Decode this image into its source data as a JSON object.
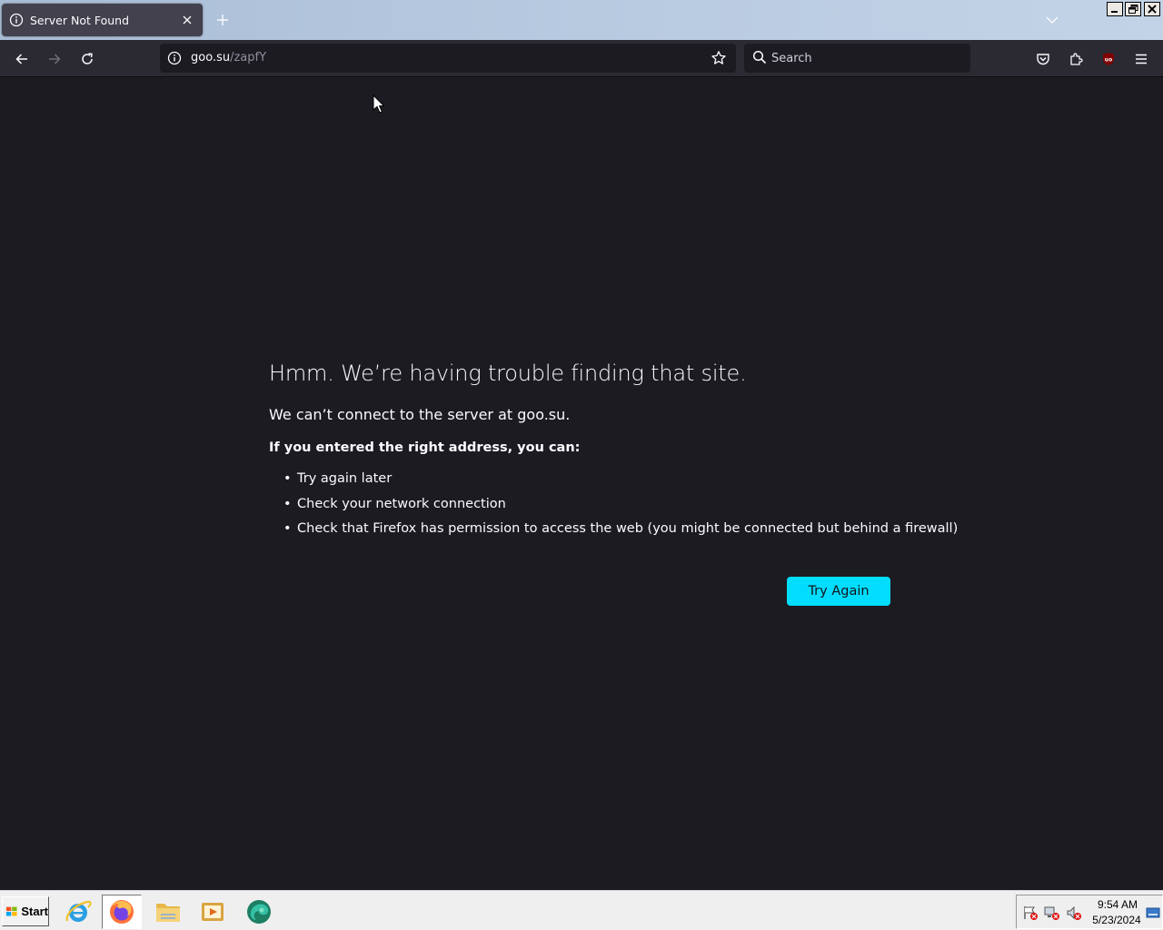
{
  "browser": {
    "tab": {
      "title": "Server Not Found",
      "icon": "info-icon"
    },
    "url": {
      "host": "goo.su",
      "path": "/zapfY"
    },
    "search": {
      "placeholder": "Search"
    }
  },
  "error_page": {
    "title": "Hmm. We’re having trouble finding that site.",
    "short_desc": "We can’t connect to the server at goo.su.",
    "lead": "If you entered the right address, you can:",
    "suggestions": [
      "Try again later",
      "Check your network connection",
      "Check that Firefox has permission to access the web (you might be connected but behind a firewall)"
    ],
    "button_label": "Try Again"
  },
  "taskbar": {
    "start_label": "Start",
    "apps": [
      "internet-explorer",
      "firefox",
      "file-explorer",
      "media-player",
      "edge"
    ],
    "clock": {
      "time": "9:54 AM",
      "date": "5/23/2024"
    }
  },
  "colors": {
    "accent_button": "#00ddff",
    "page_bg": "#1c1b22",
    "toolbar_bg": "#2b2a33"
  }
}
